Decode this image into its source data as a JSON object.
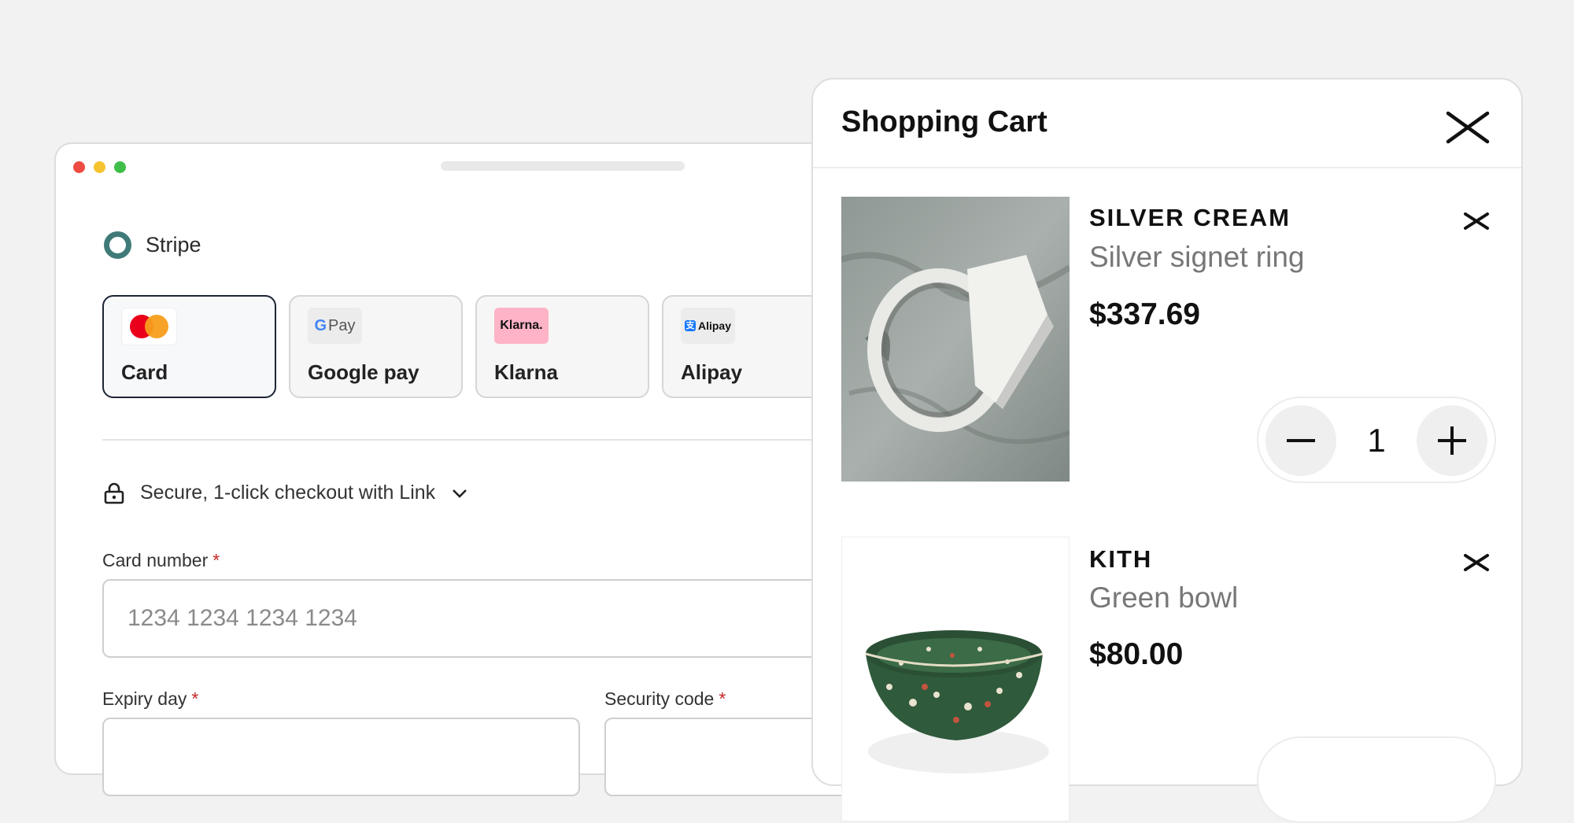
{
  "window": {
    "dots": [
      "#ee4b43",
      "#f5c330",
      "#3fbf4a"
    ]
  },
  "checkout": {
    "provider": "Stripe",
    "methods": [
      {
        "label": "Card",
        "logo": "mastercard-logo",
        "selected": true
      },
      {
        "label": "Google pay",
        "logo_text": "Pay",
        "logo_g": "G",
        "selected": false
      },
      {
        "label": "Klarna",
        "logo_text": "Klarna.",
        "selected": false
      },
      {
        "label": "Alipay",
        "logo_text": "Alipay",
        "logo_mark": "支",
        "selected": false
      }
    ],
    "link_text": "Secure, 1-click checkout with Link",
    "card_number_label": "Card number",
    "card_number_placeholder": "1234 1234 1234 1234",
    "expiry_label": "Expiry day",
    "security_label": "Security code",
    "required_mark": "*"
  },
  "cart": {
    "title": "Shopping Cart",
    "items": [
      {
        "brand": "SILVER CREAM",
        "name": "Silver signet ring",
        "price": "$337.69",
        "qty": "1"
      },
      {
        "brand": "KITH",
        "name": "Green bowl",
        "price": "$80.00"
      }
    ]
  },
  "colors": {
    "accent": "#3f7a78",
    "selected_border": "#1c2536",
    "required": "#c62828"
  }
}
